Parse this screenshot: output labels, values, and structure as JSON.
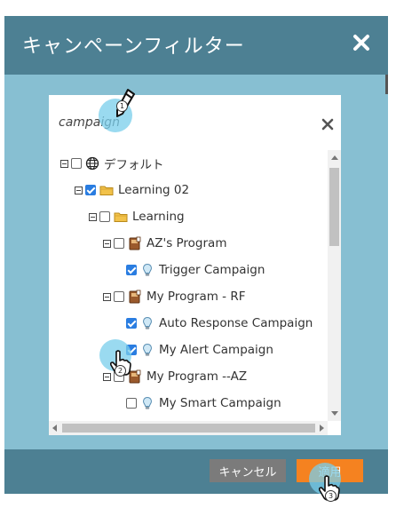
{
  "dialog": {
    "title": "キャンペーンフィルター",
    "colors": {
      "header": "#4d8093",
      "body": "#87bfd2",
      "accent": "#f58220",
      "check": "#2a7de1"
    }
  },
  "search": {
    "value": "campaign"
  },
  "tree": [
    {
      "label": "デフォルト",
      "icon": "globe-icon",
      "checked": false,
      "expander": true
    },
    {
      "label": "Learning 02",
      "icon": "folder-icon",
      "checked": true,
      "expander": true
    },
    {
      "label": "Learning",
      "icon": "folder-icon",
      "checked": false,
      "expander": true
    },
    {
      "label": "AZ's Program",
      "icon": "program-icon",
      "checked": false,
      "expander": true
    },
    {
      "label": "Trigger Campaign",
      "icon": "lightbulb-icon",
      "checked": true,
      "expander": false
    },
    {
      "label": "My Program - RF",
      "icon": "program-icon",
      "checked": false,
      "expander": true
    },
    {
      "label": "Auto Response Campaign",
      "icon": "lightbulb-icon",
      "checked": true,
      "expander": false
    },
    {
      "label": "My Alert Campaign",
      "icon": "lightbulb-icon",
      "checked": true,
      "expander": false
    },
    {
      "label": "My Program --AZ",
      "icon": "program-icon",
      "checked": false,
      "expander": true
    },
    {
      "label": "My Smart Campaign",
      "icon": "lightbulb-icon",
      "checked": false,
      "expander": false
    }
  ],
  "footer": {
    "cancel_label": "キャンセル",
    "apply_label": "適用"
  },
  "steps": [
    "1",
    "2",
    "3"
  ]
}
